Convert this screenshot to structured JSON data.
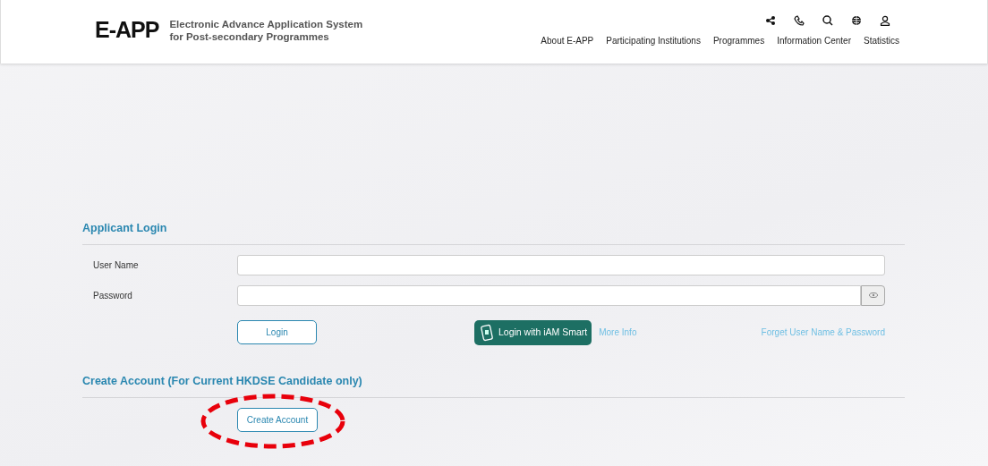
{
  "header": {
    "logo": "E-APP",
    "title_lines": [
      "Electronic Advance Application System",
      "for Post-secondary Programmes"
    ],
    "nav": [
      "About E-APP",
      "Participating Institutions",
      "Programmes",
      "Information Center",
      "Statistics"
    ]
  },
  "login": {
    "heading": "Applicant Login",
    "fields": [
      {
        "label": "User Name",
        "kind": "text"
      },
      {
        "label": "Password",
        "kind": "password"
      }
    ],
    "login_button": "Login",
    "iam_button": "Login with iAM Smart",
    "more_info": "More Info",
    "forget_link": "Forget User Name & Password"
  },
  "create": {
    "heading": "Create Account (For Current HKDSE Candidate only)",
    "button": "Create Account"
  },
  "annotation": {
    "kind": "ellipse"
  }
}
